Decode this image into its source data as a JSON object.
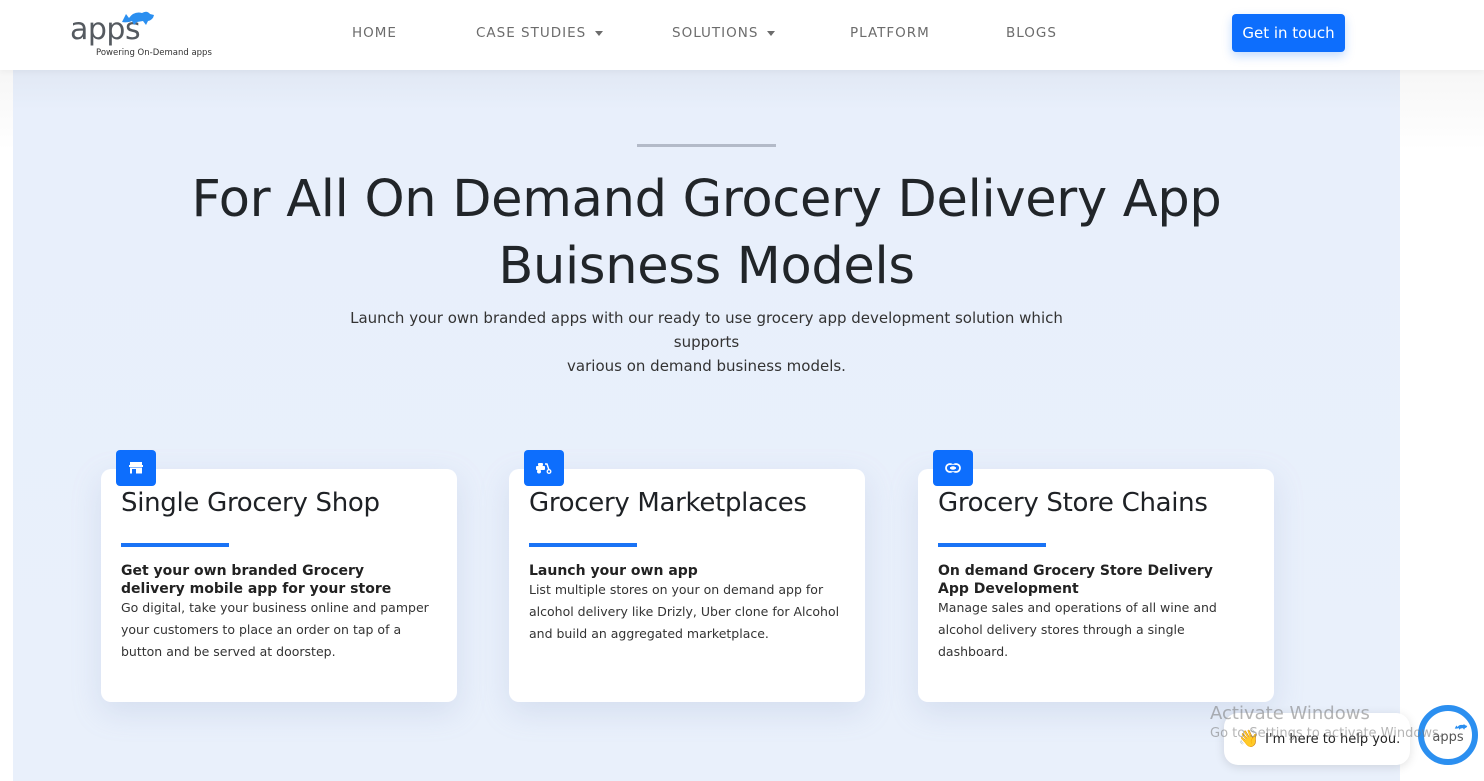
{
  "header": {
    "logo": {
      "wordmark": "apps",
      "tagline": "Powering On-Demand apps",
      "icon": "rhino-logo-icon"
    },
    "nav": [
      {
        "label": "HOME",
        "dropdown": false
      },
      {
        "label": "CASE STUDIES",
        "dropdown": true
      },
      {
        "label": "SOLUTIONS",
        "dropdown": true
      },
      {
        "label": "PLATFORM",
        "dropdown": false
      },
      {
        "label": "BLOGS",
        "dropdown": false
      }
    ],
    "cta_label": "Get in touch"
  },
  "hero": {
    "title_line1": "For All On Demand Grocery Delivery App",
    "title_line2": "Buisness Models",
    "subtitle_line1": "Launch your own branded apps with our ready to use grocery app development solution which supports",
    "subtitle_line2": "various on demand business models."
  },
  "cards": [
    {
      "icon": "store-icon",
      "title": "Single Grocery Shop",
      "subtitle": "Get your own branded Grocery delivery mobile app for your store",
      "text": "Go digital, take your business online and pamper your customers to place an order on tap of a button and be served at doorstep."
    },
    {
      "icon": "scooter-icon",
      "title": "Grocery Marketplaces",
      "subtitle": "Launch your own app",
      "text": "List multiple stores on your on demand app for alcohol delivery like Drizly, Uber clone for Alcohol and build an aggregated marketplace."
    },
    {
      "icon": "link-icon",
      "title": "Grocery Store Chains",
      "subtitle": "On demand Grocery Store Delivery App Development",
      "text": "Manage sales and operations of all wine and alcohol delivery stores through a single dashboard."
    }
  ],
  "chat": {
    "message": "I'm here to help you.",
    "emoji": "👋",
    "launcher_label": "apps"
  },
  "watermark": {
    "line1": "Activate Windows",
    "line2": "Go to Settings to activate Windows."
  },
  "colors": {
    "primary": "#0d6efd",
    "hero_bg": "#e9f0fb",
    "accent_bar": "#1a73f5",
    "chat_ring": "#2b8ff0"
  }
}
